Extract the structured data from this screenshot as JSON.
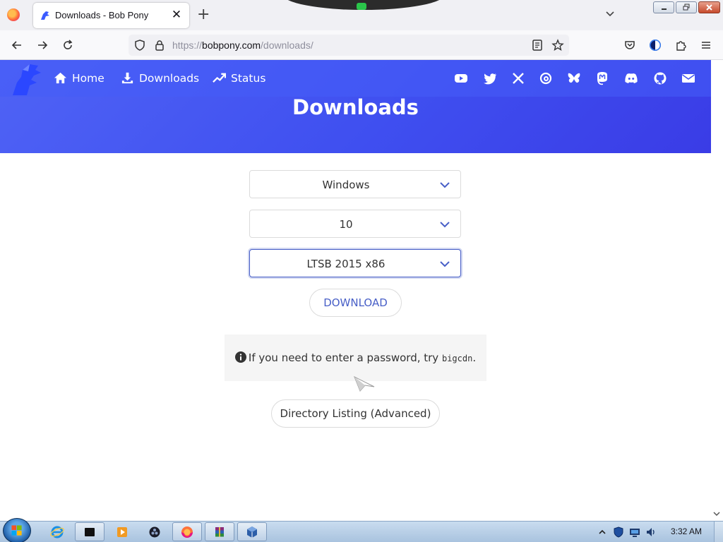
{
  "browser": {
    "tab_title": "Downloads - Bob Pony",
    "tab_close_glyph": "✕",
    "new_tab_glyph": "+",
    "url_prefix": "https://",
    "url_host": "bobpony.com",
    "url_path": "/downloads/",
    "icons": [
      "firefox-menu-icon",
      "back-icon",
      "forward-icon",
      "reload-icon",
      "shield-icon",
      "lock-icon",
      "reader-icon",
      "bookmark-star-icon",
      "pocket-icon",
      "account-icon",
      "extensions-icon",
      "hamburger-menu-icon",
      "tab-list-icon"
    ]
  },
  "site": {
    "nav": [
      {
        "label": "Home",
        "icon": "home-icon"
      },
      {
        "label": "Downloads",
        "icon": "download-icon"
      },
      {
        "label": "Status",
        "icon": "trend-icon"
      }
    ],
    "social_icons": [
      "youtube-icon",
      "twitter-icon",
      "x-icon",
      "threads-icon",
      "bluesky-icon",
      "mastodon-icon",
      "discord-icon",
      "github-icon",
      "email-icon"
    ],
    "heading": "Downloads",
    "accent": "#485fc7",
    "header_color": "#4150f0"
  },
  "form": {
    "os_select": "Windows",
    "version_select": "10",
    "edition_select": "LTSB 2015 x86",
    "download_label": "DOWNLOAD",
    "notice_text": "If you need to enter a password, try",
    "notice_code": "bigcdn",
    "notice_end": ".",
    "directory_label": "Directory Listing (Advanced)"
  },
  "taskbar": {
    "clock": "3:32 AM",
    "items": [
      "ie-icon",
      "terminal-icon",
      "media-player-icon",
      "obs-icon",
      "firefox-icon",
      "winrar-icon",
      "virtualbox-icon"
    ]
  }
}
